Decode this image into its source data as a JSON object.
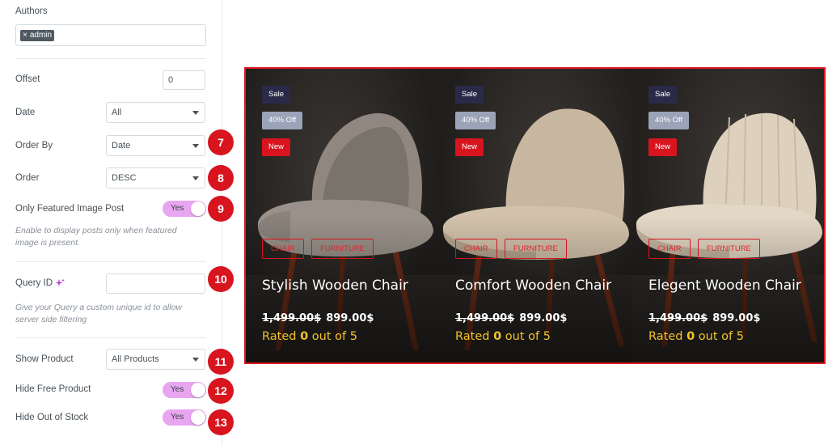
{
  "panel": {
    "authors": {
      "label": "Authors",
      "tags": [
        {
          "remove": "×",
          "text": "admin"
        }
      ]
    },
    "offset": {
      "label": "Offset",
      "value": "0"
    },
    "date": {
      "label": "Date",
      "value": "All"
    },
    "order_by": {
      "label": "Order By",
      "value": "Date"
    },
    "order": {
      "label": "Order",
      "value": "DESC"
    },
    "featured": {
      "label": "Only Featured Image Post",
      "toggle": "Yes",
      "description": "Enable to display posts only when featured image is present."
    },
    "query_id": {
      "label": "Query ID",
      "value": "",
      "description": "Give your Query a custom unique id to allow server side filtering"
    },
    "show_product": {
      "label": "Show Product",
      "value": "All Products"
    },
    "hide_free": {
      "label": "Hide Free Product",
      "toggle": "Yes"
    },
    "hide_out_of_stock": {
      "label": "Hide Out of Stock",
      "toggle": "Yes"
    }
  },
  "badges": [
    "7",
    "8",
    "9",
    "10",
    "11",
    "12",
    "13"
  ],
  "products": [
    {
      "sale": "Sale",
      "discount": "40% Off",
      "new": "New",
      "categories": [
        "CHAIR",
        "FURNITURE"
      ],
      "title": "Stylish Wooden Chair",
      "old_price": "1,499.00$",
      "price": "899.00$",
      "rating_prefix": "Rated ",
      "rating_value": "0",
      "rating_suffix": " out of 5"
    },
    {
      "sale": "Sale",
      "discount": "40% Off",
      "new": "New",
      "categories": [
        "CHAIR",
        "FURNITURE"
      ],
      "title": "Comfort Wooden Chair",
      "old_price": "1,499.00$",
      "price": "899.00$",
      "rating_prefix": "Rated ",
      "rating_value": "0",
      "rating_suffix": " out of 5"
    },
    {
      "sale": "Sale",
      "discount": "40% Off",
      "new": "New",
      "categories": [
        "CHAIR",
        "FURNITURE"
      ],
      "title": "Elegent Wooden Chair",
      "old_price": "1,499.00$",
      "price": "899.00$",
      "rating_prefix": "Rated ",
      "rating_value": "0",
      "rating_suffix": " out of 5"
    }
  ],
  "colors": {
    "accent": "#d8141f",
    "toggle": "#e8a6f0",
    "rating": "#f2c32a"
  }
}
